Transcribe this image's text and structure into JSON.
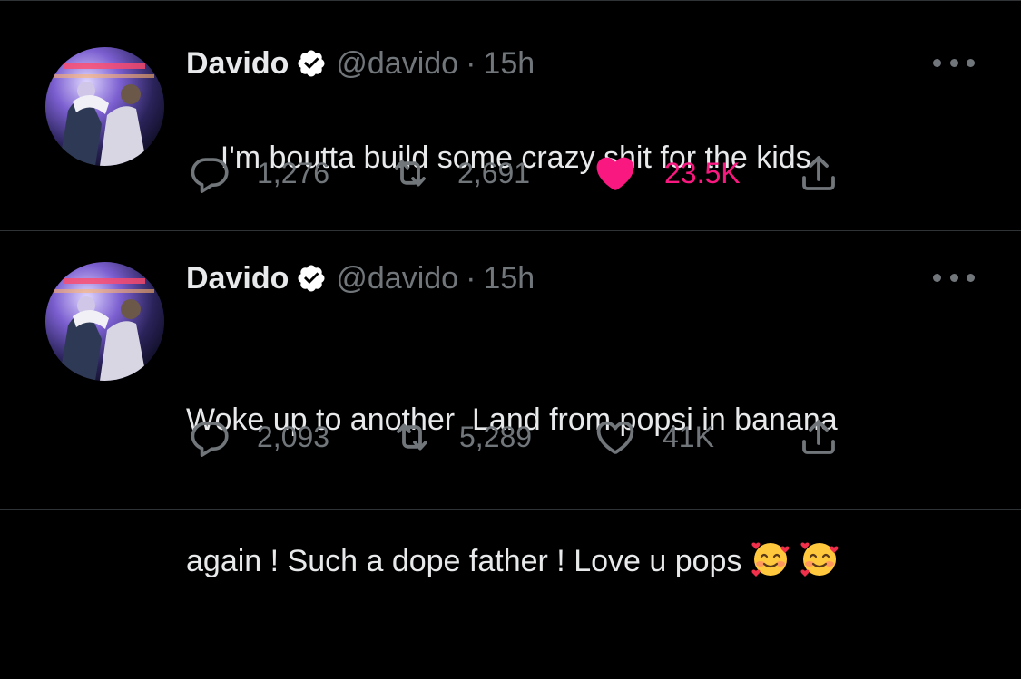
{
  "tweets": [
    {
      "author_name": "Davido",
      "handle": "@davido",
      "separator": "·",
      "time": "15h",
      "text": "I'm boutta build some crazy shit for the kids",
      "text_line2": "",
      "emojis": [],
      "replies": "1,276",
      "retweets": "2,691",
      "likes": "23.5K",
      "liked": true,
      "icons": [
        "reply-icon",
        "retweet-icon",
        "heart-filled-icon",
        "share-icon",
        "more-icon"
      ]
    },
    {
      "author_name": "Davido",
      "handle": "@davido",
      "separator": "·",
      "time": "15h",
      "text": "Woke up to another  Land from popsi in banana",
      "text_line2": "again ! Such a dope father ! Love u pops",
      "emojis": [
        "smiling-face-with-hearts",
        "smiling-face-with-hearts"
      ],
      "replies": "2,093",
      "retweets": "5,289",
      "likes": "41K",
      "liked": false,
      "icons": [
        "reply-icon",
        "retweet-icon",
        "heart-outline-icon",
        "share-icon",
        "more-icon"
      ]
    }
  ],
  "colors": {
    "background": "#000000",
    "primary_text": "#e7e9ea",
    "secondary_text": "#71767b",
    "like_pink": "#f91880",
    "divider": "#2f3336",
    "verified_badge": "#ffffff"
  }
}
